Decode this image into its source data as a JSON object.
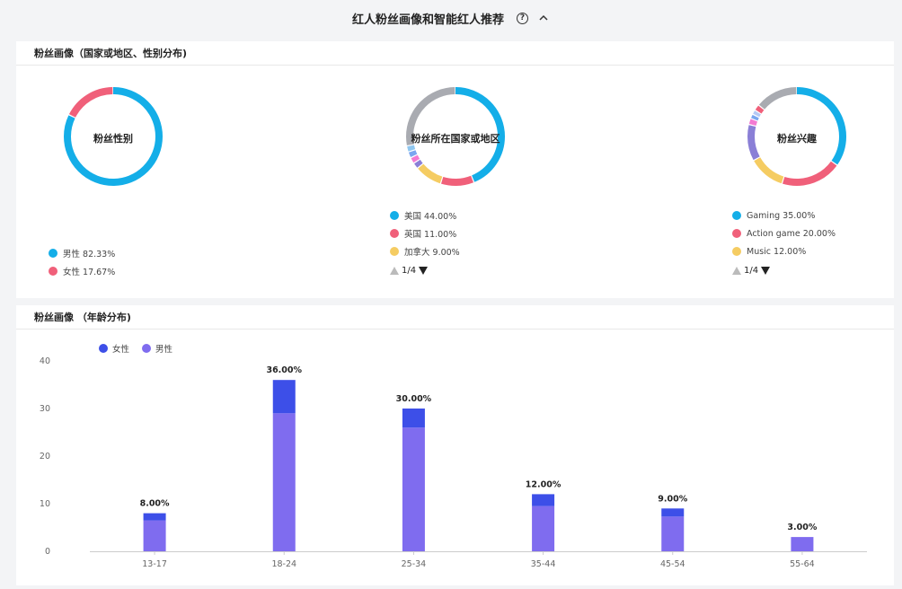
{
  "header": {
    "title": "红人粉丝画像和智能红人推荐",
    "help_icon": "question-circle-icon",
    "collapse_icon": "chevron-up-icon"
  },
  "top_panel": {
    "title": "粉丝画像（国家或地区、性别分布)",
    "gender": {
      "center_label": "粉丝性别",
      "segments": [
        {
          "label": "男性",
          "value": 82.33,
          "display": "男性 82.33%",
          "color": "#14aee8"
        },
        {
          "label": "女性",
          "value": 17.67,
          "display": "女性 17.67%",
          "color": "#f0607a"
        }
      ]
    },
    "country": {
      "center_label": "粉丝所在国家或地区",
      "segments": [
        {
          "label": "美国",
          "value": 44.0,
          "color": "#14aee8"
        },
        {
          "label": "英国",
          "value": 11.0,
          "color": "#f0607a"
        },
        {
          "label": "加拿大",
          "value": 9.0,
          "color": "#f5cc62"
        },
        {
          "label": "",
          "value": 2.0,
          "color": "#8a7fd6"
        },
        {
          "label": "",
          "value": 2.0,
          "color": "#f37ad2"
        },
        {
          "label": "",
          "value": 2.0,
          "color": "#7aa6f0"
        },
        {
          "label": "",
          "value": 2.0,
          "color": "#8fc7f0"
        },
        {
          "label": "",
          "value": 28.0,
          "color": "#a9abb1"
        }
      ],
      "legend": [
        {
          "display": "美国 44.00%",
          "color": "#14aee8"
        },
        {
          "display": "英国 11.00%",
          "color": "#f0607a"
        },
        {
          "display": "加拿大 9.00%",
          "color": "#f5cc62"
        }
      ],
      "pager": "1/4"
    },
    "interest": {
      "center_label": "粉丝兴趣",
      "segments": [
        {
          "label": "Gaming",
          "value": 35.0,
          "color": "#14aee8"
        },
        {
          "label": "Action game",
          "value": 20.0,
          "color": "#f0607a"
        },
        {
          "label": "Music",
          "value": 12.0,
          "color": "#f5cc62"
        },
        {
          "label": "",
          "value": 12.0,
          "color": "#8a7fd6"
        },
        {
          "label": "",
          "value": 2.0,
          "color": "#f37ad2"
        },
        {
          "label": "",
          "value": 1.5,
          "color": "#7aa6f0"
        },
        {
          "label": "",
          "value": 1.5,
          "color": "#b5c9f5"
        },
        {
          "label": "",
          "value": 2.0,
          "color": "#f0607a"
        },
        {
          "label": "",
          "value": 14.0,
          "color": "#a9abb1"
        }
      ],
      "legend": [
        {
          "display": "Gaming 35.00%",
          "color": "#14aee8"
        },
        {
          "display": "Action game 20.00%",
          "color": "#f0607a"
        },
        {
          "display": "Music 12.00%",
          "color": "#f5cc62"
        }
      ],
      "pager": "1/4"
    }
  },
  "bottom_panel": {
    "title": "粉丝画像 （年龄分布)"
  },
  "chart_data": {
    "type": "bar",
    "stacked": true,
    "categories": [
      "13-17",
      "18-24",
      "25-34",
      "35-44",
      "45-54",
      "55-64"
    ],
    "series": [
      {
        "name": "女性",
        "color": "#3d4fe8",
        "values": [
          1.5,
          7.0,
          4.0,
          2.5,
          1.7,
          0.0
        ]
      },
      {
        "name": "男性",
        "color": "#7f6cef",
        "values": [
          6.5,
          29.0,
          26.0,
          9.5,
          7.3,
          3.0
        ]
      }
    ],
    "totals_labels": [
      "8.00%",
      "36.00%",
      "30.00%",
      "12.00%",
      "9.00%",
      "3.00%"
    ],
    "totals": [
      8,
      36,
      30,
      12,
      9,
      3
    ],
    "ylim": [
      0,
      40
    ],
    "yticks": [
      0,
      10,
      20,
      30,
      40
    ],
    "grid": false,
    "legend_position": "top-left"
  }
}
